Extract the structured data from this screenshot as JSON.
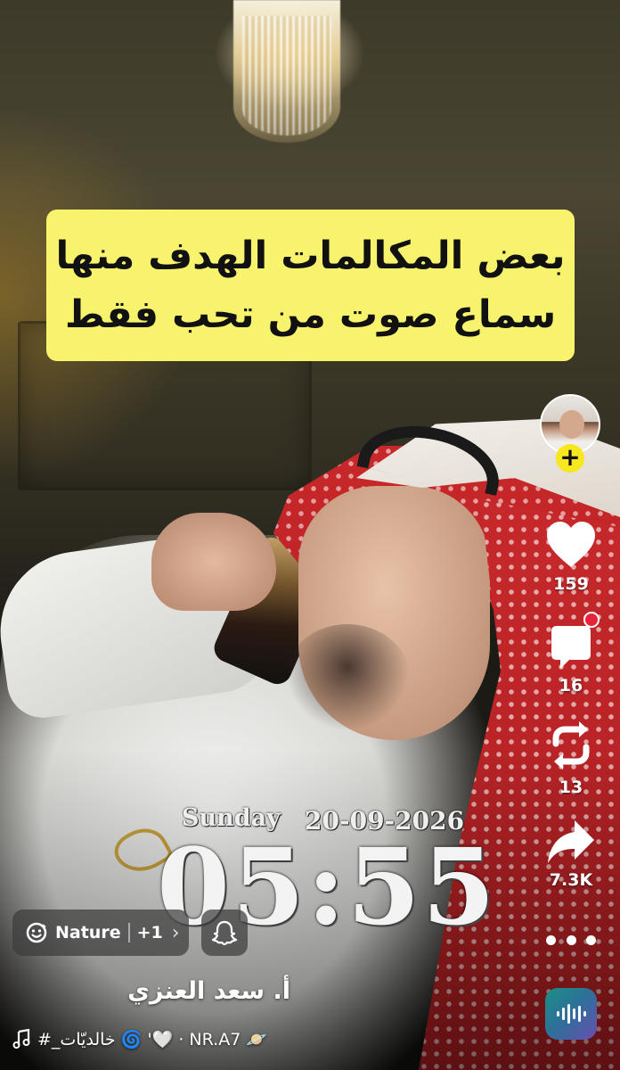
{
  "caption": {
    "line1": "بعض المكالمات الهدف منها",
    "line2": "سماع صوت من تحب فقط"
  },
  "clock_overlay": {
    "day": "Sunday",
    "date": "20-09-2026",
    "time": "05:55"
  },
  "actions": {
    "likes": "159",
    "comments": "16",
    "remixes": "13",
    "shares": "7.3K",
    "follow_symbol": "+"
  },
  "lens": {
    "name": "Nature",
    "extra": "+1",
    "chevron": "›"
  },
  "creator": {
    "name": "أ. سعد العنزي"
  },
  "sound": {
    "text": "#_خالديّات 🌀 '🤍 · NR.A7 🪐"
  },
  "colors": {
    "caption_bg": "#f8f36d",
    "follow_badge": "#f6e71e",
    "notification_dot": "#e8243c"
  },
  "icons": [
    "heart-icon",
    "comment-icon",
    "remix-icon",
    "share-icon",
    "more-icon",
    "smiley-lens-icon",
    "snapchat-ghost-icon",
    "music-note-icon",
    "sound-wave-icon",
    "plus-icon"
  ]
}
